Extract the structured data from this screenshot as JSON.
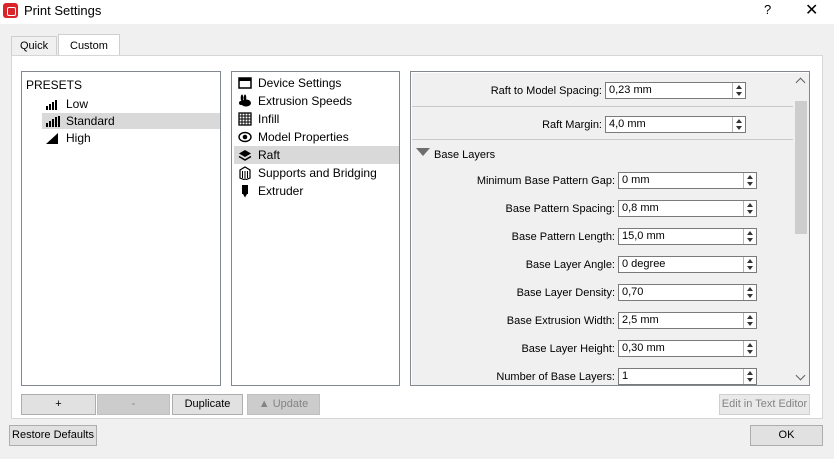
{
  "window": {
    "title": "Print Settings",
    "help_label": "?",
    "close_label": "✕"
  },
  "tabs": [
    {
      "label": "Quick",
      "active": false
    },
    {
      "label": "Custom",
      "active": true
    }
  ],
  "presets": {
    "header": "PRESETS",
    "items": [
      {
        "label": "Low",
        "selected": false,
        "icon": "quality-low-icon"
      },
      {
        "label": "Standard",
        "selected": true,
        "icon": "quality-standard-icon"
      },
      {
        "label": "High",
        "selected": false,
        "icon": "quality-high-icon"
      }
    ]
  },
  "categories": {
    "items": [
      {
        "label": "Device Settings",
        "icon": "device-icon",
        "selected": false
      },
      {
        "label": "Extrusion Speeds",
        "icon": "rabbit-icon",
        "selected": false
      },
      {
        "label": "Infill",
        "icon": "infill-icon",
        "selected": false
      },
      {
        "label": "Model Properties",
        "icon": "eye-icon",
        "selected": false
      },
      {
        "label": "Raft",
        "icon": "layers-icon",
        "selected": true
      },
      {
        "label": "Supports and Bridging",
        "icon": "supports-icon",
        "selected": false
      },
      {
        "label": "Extruder",
        "icon": "extruder-icon",
        "selected": false
      }
    ]
  },
  "settings": {
    "top_rows": [
      {
        "label": "Raft to Model Spacing:",
        "value": "0,23 mm"
      },
      {
        "label": "Raft Margin:",
        "value": "4,0 mm"
      }
    ],
    "section_label": "Base Layers",
    "base_rows": [
      {
        "label": "Minimum Base Pattern Gap:",
        "value": "0 mm"
      },
      {
        "label": "Base Pattern Spacing:",
        "value": "0,8 mm"
      },
      {
        "label": "Base Pattern Length:",
        "value": "15,0 mm"
      },
      {
        "label": "Base Layer Angle:",
        "value": "0 degree"
      },
      {
        "label": "Base Layer Density:",
        "value": "0,70"
      },
      {
        "label": "Base Extrusion Width:",
        "value": "2,5 mm"
      },
      {
        "label": "Base Layer Height:",
        "value": "0,30 mm"
      },
      {
        "label": "Number of Base Layers:",
        "value": "1"
      }
    ]
  },
  "buttons": {
    "add": "+",
    "remove": "-",
    "duplicate": "Duplicate",
    "update": "Update",
    "edit_text": "Edit in Text Editor",
    "restore": "Restore Defaults",
    "ok": "OK"
  },
  "colors": {
    "app_icon": "#d9252a",
    "selection": "#d9d9d9"
  }
}
